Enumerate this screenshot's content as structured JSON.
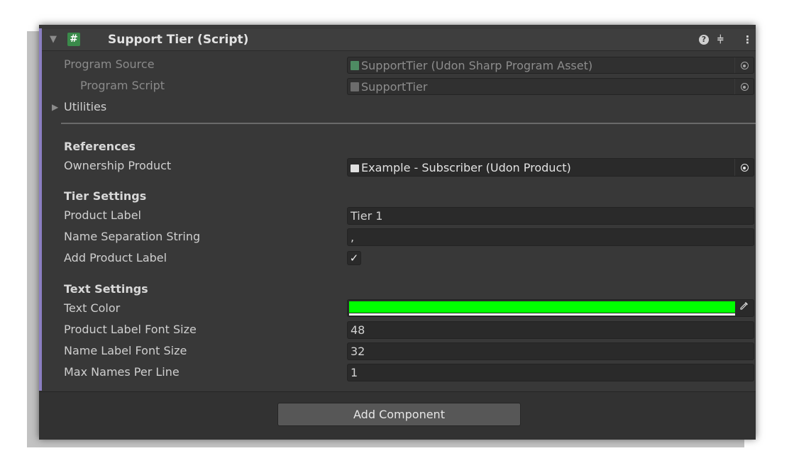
{
  "component": {
    "title": "Support Tier (Script)",
    "script_icon": "#",
    "header_icons": [
      "help-icon",
      "presets-icon",
      "more-icon"
    ]
  },
  "program": {
    "source_label": "Program Source",
    "source_value": "SupportTier (Udon Sharp Program Asset)",
    "script_label": "Program Script",
    "script_value": "SupportTier",
    "utilities_label": "Utilities"
  },
  "references": {
    "heading": "References",
    "ownership_label": "Ownership Product",
    "ownership_value": "Example - Subscriber (Udon Product)"
  },
  "tier_settings": {
    "heading": "Tier Settings",
    "product_label_label": "Product Label",
    "product_label_value": "Tier 1",
    "name_separation_label": "Name Separation String",
    "name_separation_value": ",",
    "add_product_label_label": "Add Product Label",
    "add_product_label_checked": true,
    "check_glyph": "✓"
  },
  "text_settings": {
    "heading": "Text Settings",
    "text_color_label": "Text Color",
    "text_color_value": "#00ff00",
    "product_font_size_label": "Product Label Font Size",
    "product_font_size_value": "48",
    "name_font_size_label": "Name Label Font Size",
    "name_font_size_value": "32",
    "max_names_label": "Max Names Per Line",
    "max_names_value": "1"
  },
  "footer": {
    "add_component_label": "Add Component"
  },
  "colors": {
    "panel_bg": "#383838",
    "accent": "#8b7fc2",
    "field_bg": "#2a2a2a"
  }
}
